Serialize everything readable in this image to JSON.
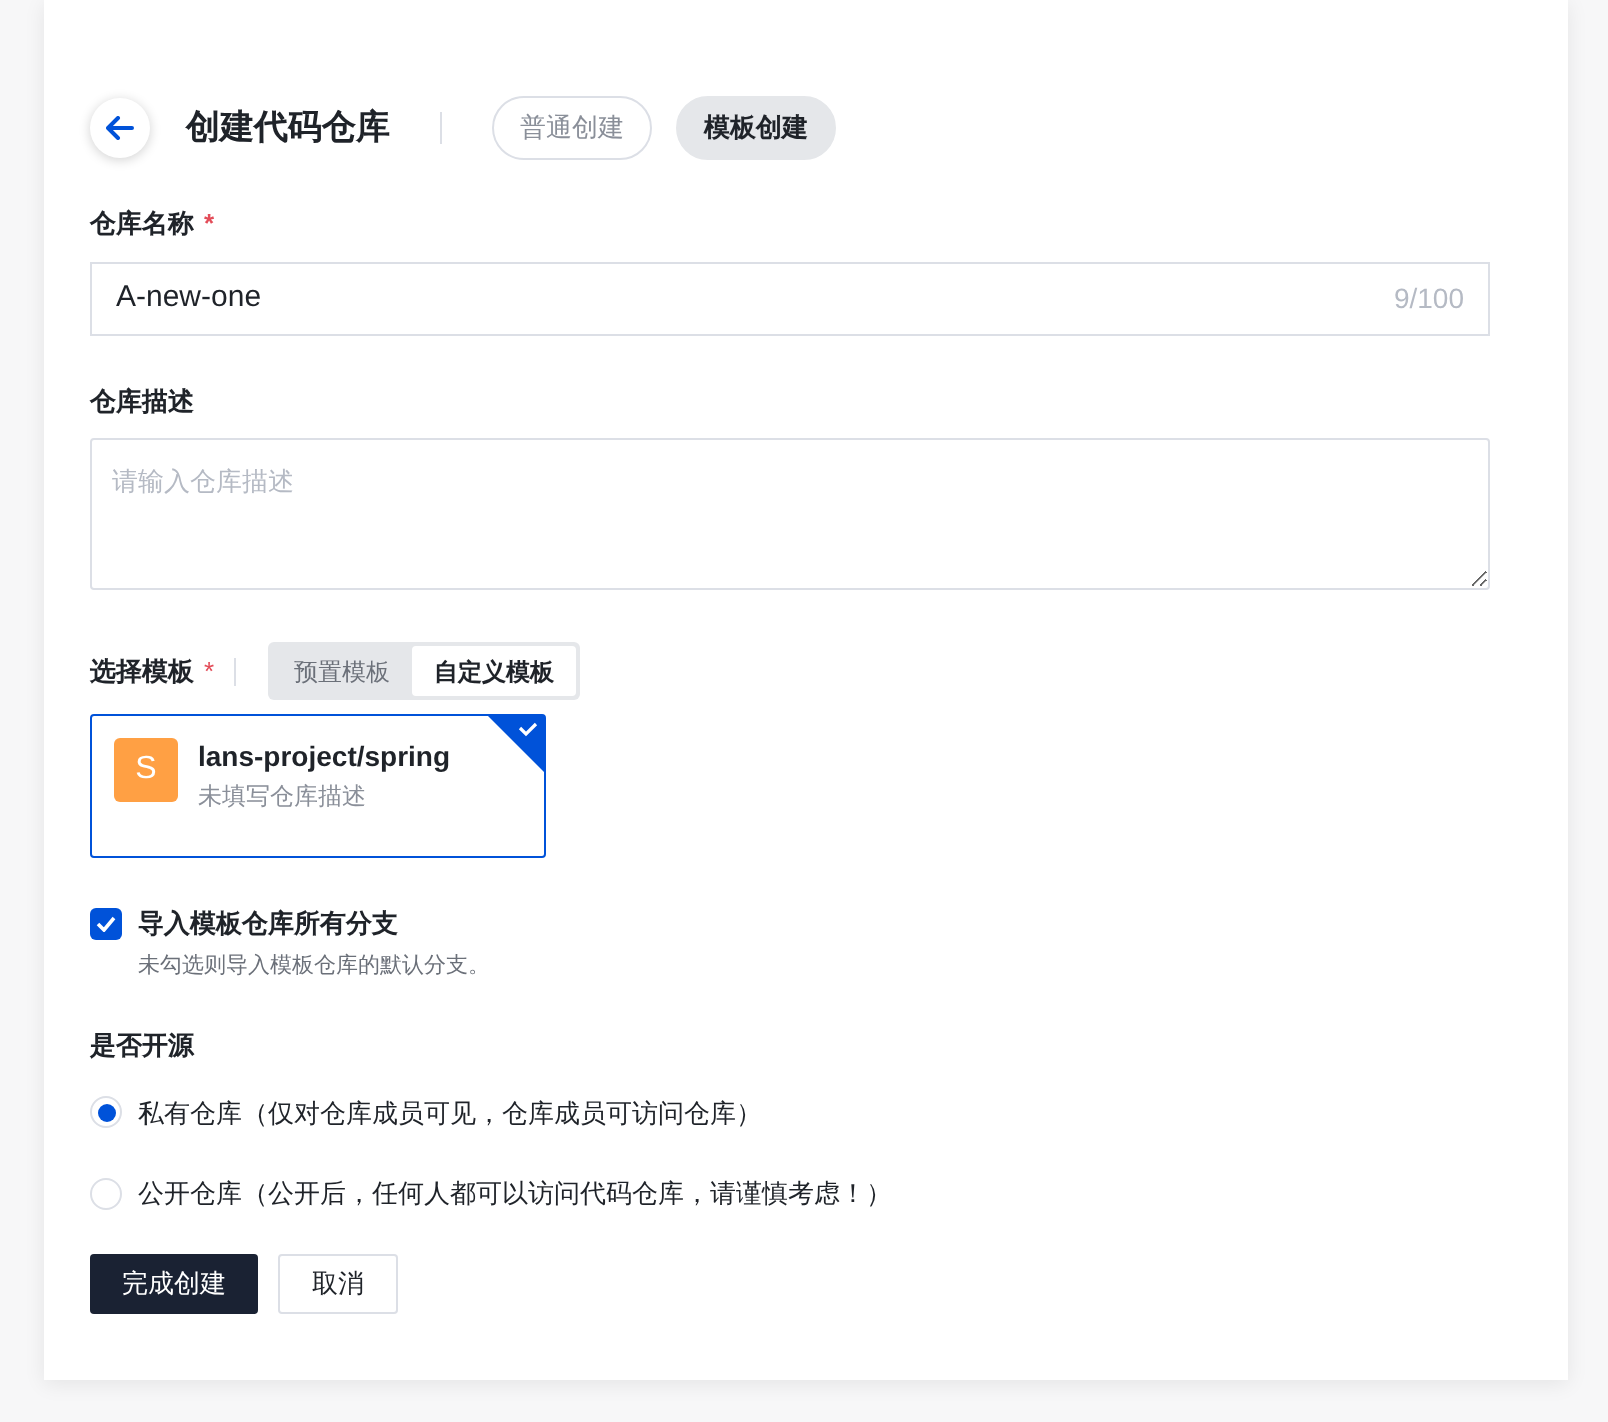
{
  "header": {
    "title": "创建代码仓库",
    "modes": [
      {
        "label": "普通创建",
        "selected": false
      },
      {
        "label": "模板创建",
        "selected": true
      }
    ]
  },
  "name_field": {
    "label": "仓库名称",
    "required": "*",
    "value": "A-new-one",
    "counter": "9/100"
  },
  "description_field": {
    "label": "仓库描述",
    "placeholder": "请输入仓库描述"
  },
  "template": {
    "label": "选择模板",
    "required": "*",
    "tabs": [
      {
        "label": "预置模板",
        "selected": false
      },
      {
        "label": "自定义模板",
        "selected": true
      }
    ],
    "cards": [
      {
        "initial": "S",
        "name": "lans-project/spring",
        "description": "未填写仓库描述",
        "color": "#ffa044",
        "selected": true
      }
    ]
  },
  "import_branches": {
    "label": "导入模板仓库所有分支",
    "hint": "未勾选则导入模板仓库的默认分支。",
    "checked": true
  },
  "visibility": {
    "label": "是否开源",
    "options": [
      {
        "label": "私有仓库（仅对仓库成员可见，仓库成员可访问仓库）",
        "selected": true
      },
      {
        "label": "公开仓库（公开后，任何人都可以访问代码仓库，请谨慎考虑！）",
        "selected": false
      }
    ]
  },
  "buttons": [
    {
      "label": "完成创建",
      "kind": "primary"
    },
    {
      "label": "取消",
      "kind": "secondary"
    }
  ]
}
